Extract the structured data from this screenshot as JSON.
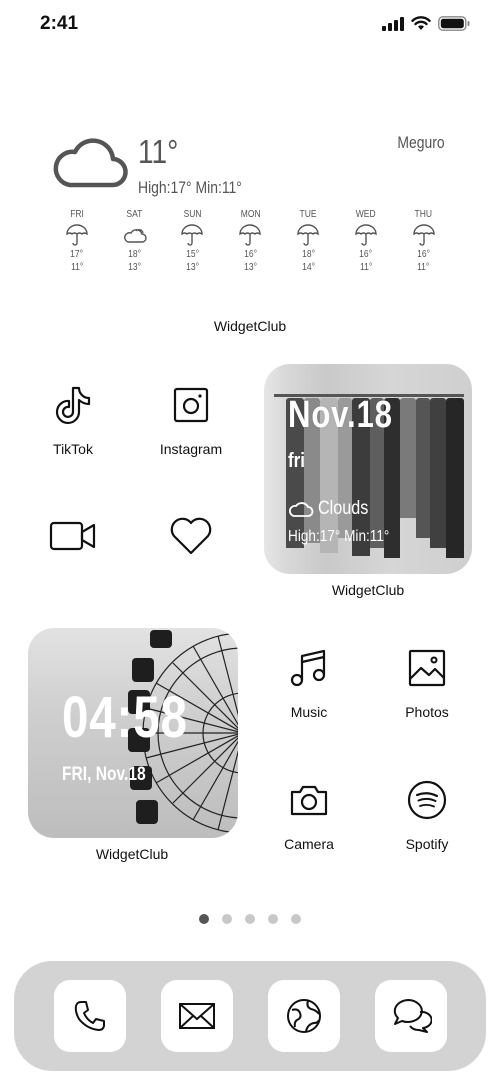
{
  "status_bar": {
    "time": "2:41",
    "icons": [
      "signal-icon",
      "wifi-icon",
      "battery-icon"
    ]
  },
  "weather_widget": {
    "current_temp": "11°",
    "high_low": "High:17° Min:11°",
    "location": "Meguro",
    "condition_icon": "cloud-icon",
    "forecast": [
      {
        "day": "FRI",
        "icon": "umbrella-icon",
        "high": "17°",
        "low": "11°"
      },
      {
        "day": "SAT",
        "icon": "cloud-icon",
        "high": "18°",
        "low": "13°"
      },
      {
        "day": "SUN",
        "icon": "umbrella-icon",
        "high": "15°",
        "low": "13°"
      },
      {
        "day": "MON",
        "icon": "umbrella-icon",
        "high": "16°",
        "low": "13°"
      },
      {
        "day": "TUE",
        "icon": "umbrella-icon",
        "high": "18°",
        "low": "14°"
      },
      {
        "day": "WED",
        "icon": "umbrella-icon",
        "high": "16°",
        "low": "11°"
      },
      {
        "day": "THU",
        "icon": "umbrella-icon",
        "high": "16°",
        "low": "11°"
      }
    ],
    "label": "WidgetClub"
  },
  "apps_row1": [
    {
      "name": "TikTok",
      "icon": "tiktok-icon"
    },
    {
      "name": "Instagram",
      "icon": "instagram-icon"
    }
  ],
  "apps_row2": [
    {
      "name": "",
      "icon": "video-camera-icon"
    },
    {
      "name": "",
      "icon": "heart-icon"
    }
  ],
  "clothes_widget": {
    "date": "Nov.18",
    "day": "fri",
    "condition": "Clouds",
    "high_low": "High:17° Min:11°",
    "label": "WidgetClub"
  },
  "clock_widget": {
    "time": "04:58",
    "date": "FRI, Nov.18",
    "label": "WidgetClub"
  },
  "apps_row3": [
    {
      "name": "Music",
      "icon": "music-note-icon"
    },
    {
      "name": "Photos",
      "icon": "photo-icon"
    }
  ],
  "apps_row4": [
    {
      "name": "Camera",
      "icon": "camera-icon"
    },
    {
      "name": "Spotify",
      "icon": "spotify-icon"
    }
  ],
  "page_dots": {
    "count": 5,
    "active_index": 0
  },
  "dock": [
    {
      "icon": "phone-icon"
    },
    {
      "icon": "mail-icon"
    },
    {
      "icon": "safari-icon"
    },
    {
      "icon": "messages-icon"
    }
  ]
}
